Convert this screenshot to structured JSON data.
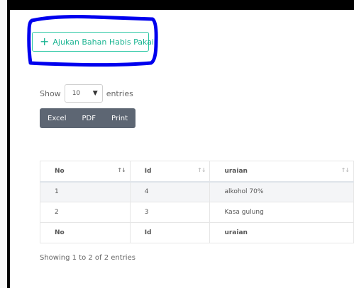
{
  "add_button": {
    "label": "Ajukan Bahan Habis Pakai",
    "icon": "plus-icon",
    "color": "#19b491"
  },
  "length": {
    "prefix": "Show",
    "selected": "10",
    "suffix": "entries"
  },
  "export": {
    "buttons": [
      "Excel",
      "PDF",
      "Print"
    ]
  },
  "table": {
    "columns": [
      "No",
      "Id",
      "uraian"
    ],
    "rows": [
      [
        "1",
        "4",
        "alkohol 70%"
      ],
      [
        "2",
        "3",
        "Kasa gulung"
      ]
    ],
    "footer": [
      "No",
      "Id",
      "uraian"
    ]
  },
  "info": "Showing 1 to 2 of 2 entries",
  "annotation_color": "#0000ee"
}
